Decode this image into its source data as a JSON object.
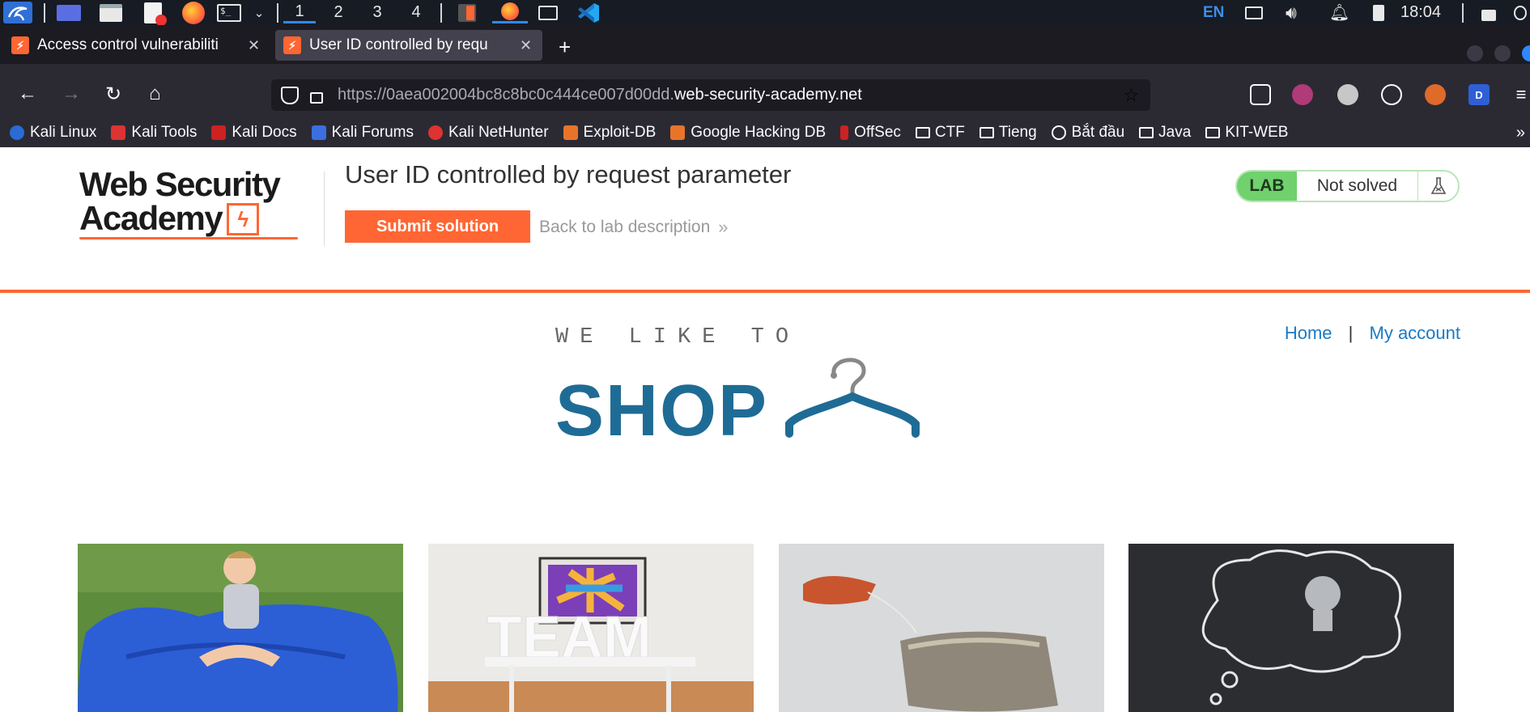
{
  "taskbar": {
    "workspaces": [
      "1",
      "2",
      "3",
      "4"
    ],
    "active_workspace": "1",
    "language": "EN",
    "time": "18:04"
  },
  "tabs": [
    {
      "title": "Access control vulnerabiliti",
      "active": false
    },
    {
      "title": "User ID controlled by requ",
      "active": true
    }
  ],
  "url": {
    "prefix": "https://0aea002004bc8c8bc0c444ce007d00dd.",
    "domain": "web-security-academy.net"
  },
  "bookmarks": [
    {
      "label": "Kali Linux",
      "icon": "kali-icon"
    },
    {
      "label": "Kali Tools",
      "icon": "kali-tools-icon"
    },
    {
      "label": "Kali Docs",
      "icon": "kali-docs-icon"
    },
    {
      "label": "Kali Forums",
      "icon": "kali-forums-icon"
    },
    {
      "label": "Kali NetHunter",
      "icon": "nethunter-icon"
    },
    {
      "label": "Exploit-DB",
      "icon": "exploitdb-icon"
    },
    {
      "label": "Google Hacking DB",
      "icon": "ghdb-icon"
    },
    {
      "label": "OffSec",
      "icon": "offsec-icon"
    },
    {
      "label": "CTF",
      "icon": "folder-icon"
    },
    {
      "label": "Tieng",
      "icon": "folder-icon"
    },
    {
      "label": "Bắt đầu",
      "icon": "globe-icon"
    },
    {
      "label": "Java",
      "icon": "folder-icon"
    },
    {
      "label": "KIT-WEB",
      "icon": "folder-icon"
    }
  ],
  "header": {
    "logo_line1": "Web Security",
    "logo_line2": "Academy",
    "lab_title": "User ID controlled by request parameter",
    "submit_label": "Submit solution",
    "back_label": "Back to lab description",
    "badge_lab": "LAB",
    "badge_status": "Not solved"
  },
  "nav": {
    "home": "Home",
    "separator": "|",
    "account": "My account"
  },
  "shop": {
    "tagline": "WE LIKE TO",
    "word": "SHOP"
  },
  "colors": {
    "accent": "#ff6633",
    "link": "#1a7bc4",
    "shop_blue": "#1e6c95",
    "lab_green": "#70d16d"
  }
}
